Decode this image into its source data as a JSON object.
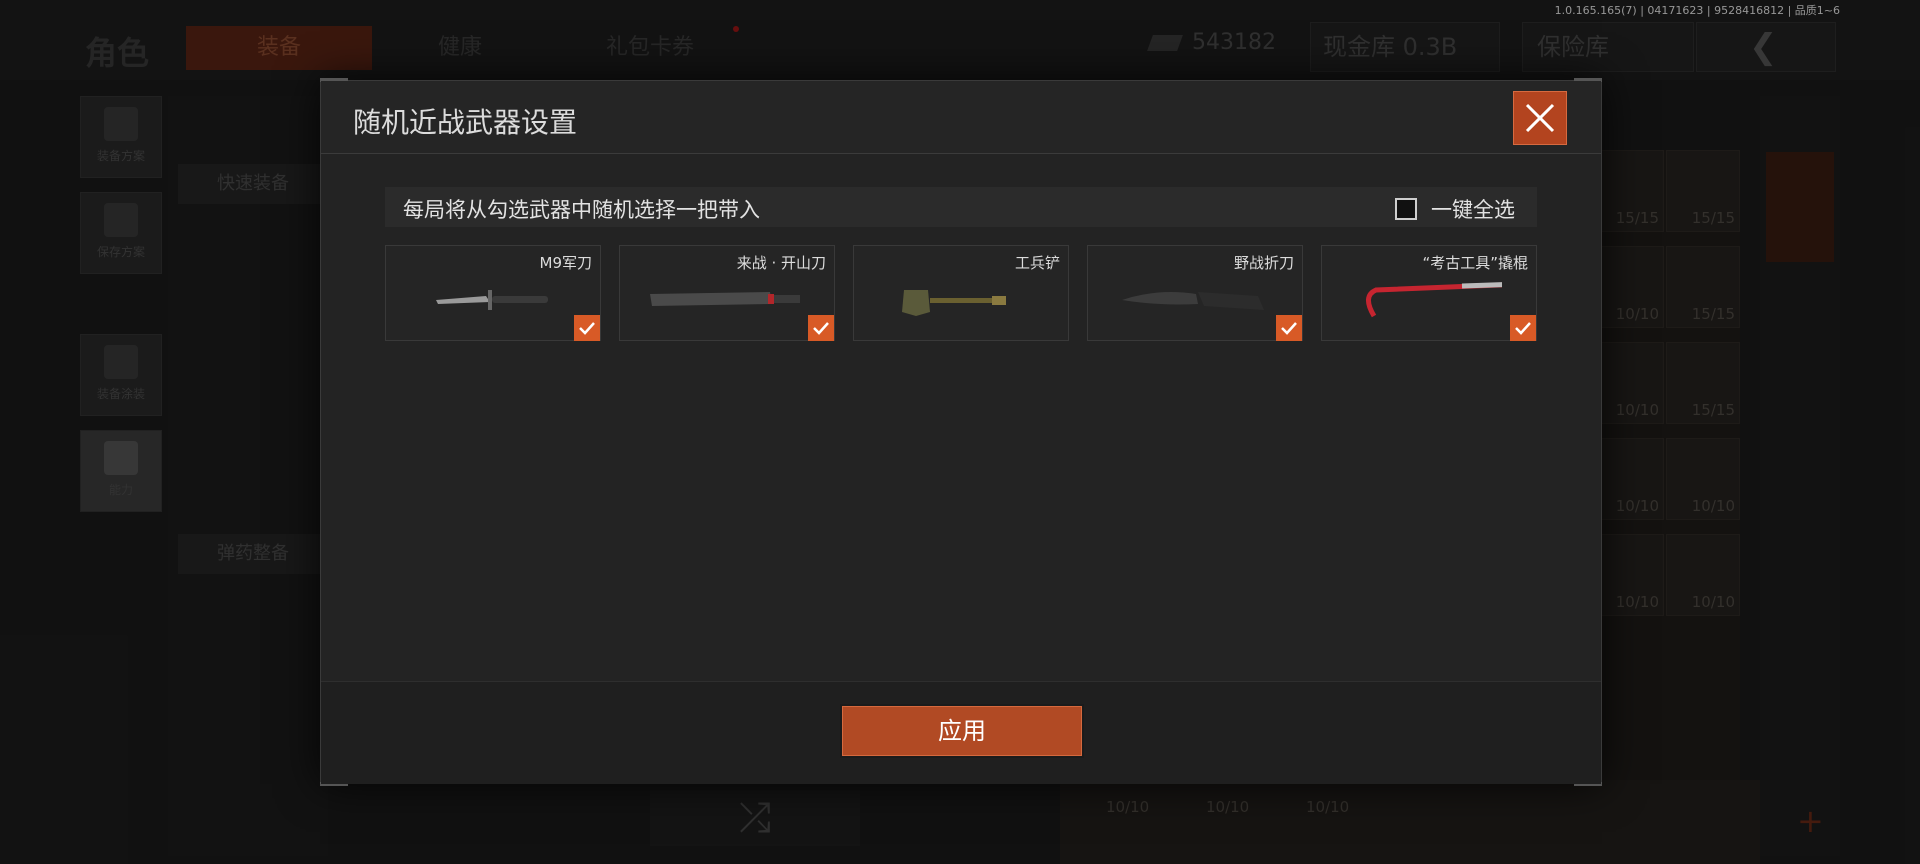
{
  "version_text": "1.0.165.165(7) | 04171623 | 9528416812 | 品质1~6",
  "background": {
    "title": "角色",
    "tabs": [
      "装备",
      "健康",
      "礼包卡券"
    ],
    "money": "543182",
    "cash_vault": "现金库 0.3B",
    "insurance": "保险库",
    "left_buttons": [
      "装备方案",
      "保存方案",
      "装备涂装",
      "能力"
    ],
    "quick_equip": "快速装备",
    "ammo_setup": "弹药整备",
    "counts": [
      "15/15",
      "15/15",
      "10/10",
      "15/15",
      "10/10",
      "15/15",
      "10/10",
      "10/10",
      "10/10",
      "10/10",
      "10/10",
      "10/10",
      "10/10"
    ]
  },
  "modal": {
    "title": "随机近战武器设置",
    "hint": "每局将从勾选武器中随机选择一把带入",
    "select_all_label": "一键全选",
    "select_all_checked": false,
    "weapons": [
      {
        "name": "M9军刀",
        "checked": true
      },
      {
        "name": "来战 · 开山刀",
        "checked": true
      },
      {
        "name": "工兵铲",
        "checked": false
      },
      {
        "name": "野战折刀",
        "checked": true
      },
      {
        "name": "“考古工具”撬棍",
        "checked": true
      }
    ],
    "apply_label": "应用"
  },
  "colors": {
    "accent": "#d85a26",
    "button": "#b14a24"
  }
}
